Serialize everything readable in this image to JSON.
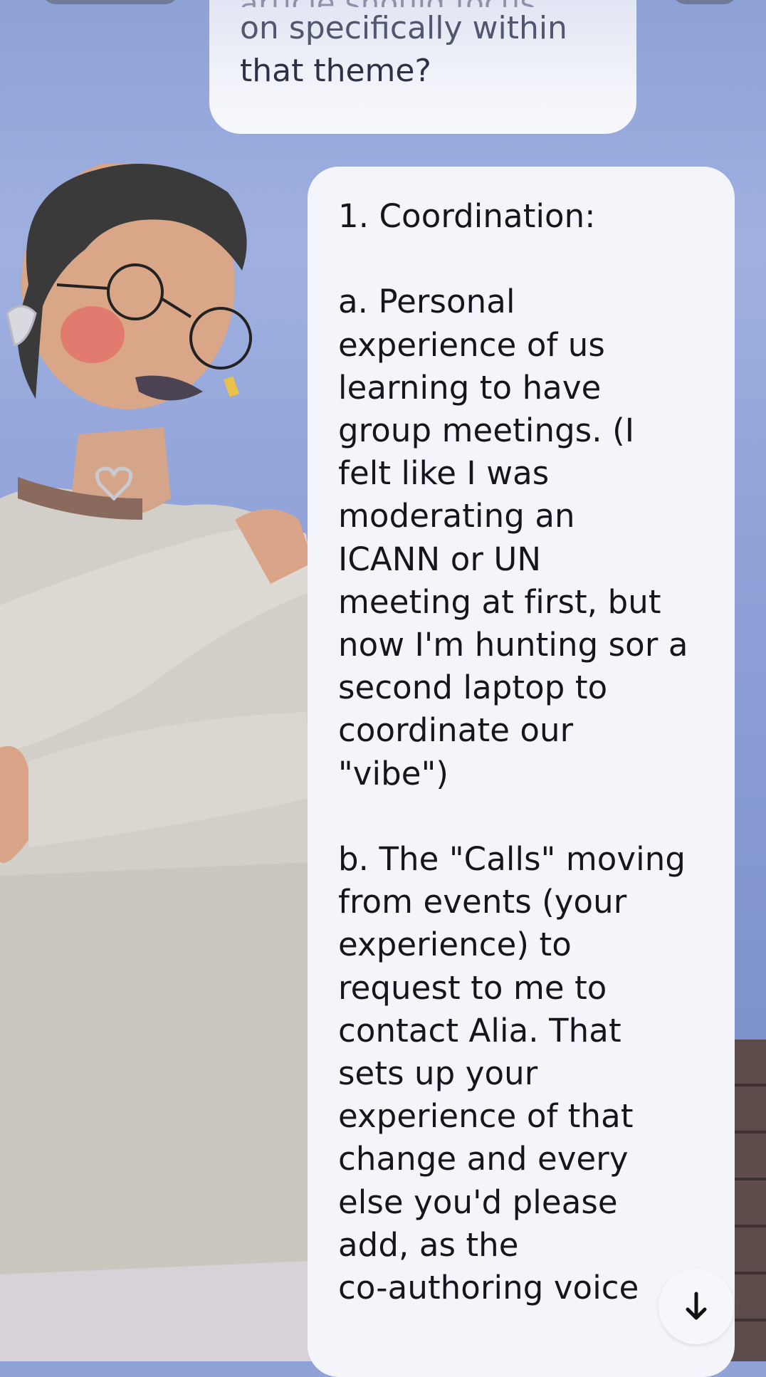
{
  "user_message": {
    "cut_off_line": "article should focus",
    "lines": [
      "on specifically within",
      "that theme?"
    ]
  },
  "ai_message": {
    "lines": [
      "1. Coordination:",
      "",
      "a. Personal",
      "experience of us",
      "learning to have",
      "group meetings. (I",
      "felt like I was",
      "moderating an",
      "ICANN or UN",
      "meeting at first, but",
      "now I'm hunting sor a",
      "second laptop to",
      "coordinate our",
      "\"vibe\")",
      "",
      "b. The \"Calls\" moving",
      "from events (your",
      "experience) to",
      "request to me to",
      "contact Alia. That",
      "sets up your",
      "experience of that",
      "change and every",
      "else you'd please",
      "add, as the",
      "co-authoring voice"
    ]
  },
  "scroll_button": {
    "icon": "arrow-down-icon"
  },
  "colors": {
    "background": "#8fa2d8",
    "bubble": "#f4f5fa",
    "text": "#15161c"
  }
}
